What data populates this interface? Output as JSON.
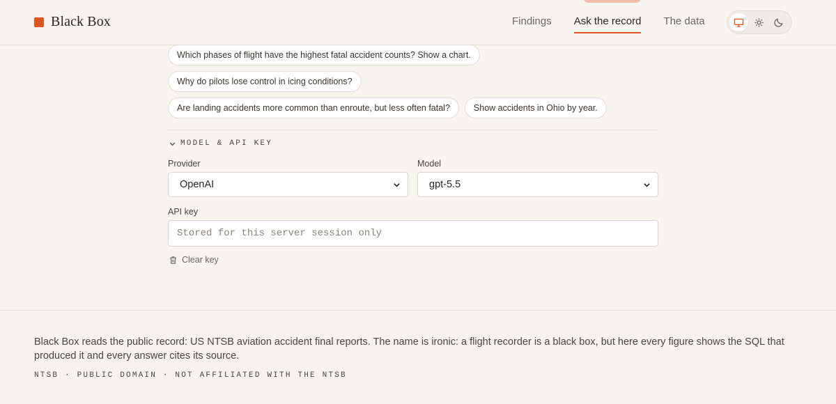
{
  "header": {
    "brand": "Black Box",
    "nav": [
      {
        "label": "Findings"
      },
      {
        "label": "Ask the record"
      },
      {
        "label": "The data"
      }
    ],
    "theme_modes": [
      "monitor-icon",
      "sun-icon",
      "moon-icon"
    ],
    "active_theme": "system"
  },
  "suggestions": [
    "Which phases of flight have the highest fatal accident counts? Show a chart.",
    "Why do pilots lose control in icing conditions?",
    "Are landing accidents more common than enroute, but less often fatal?",
    "Show accidents in Ohio by year."
  ],
  "settings": {
    "section_title": "MODEL & API KEY",
    "provider_label": "Provider",
    "provider_value": "OpenAI",
    "model_label": "Model",
    "model_value": "gpt-5.5",
    "api_key_label": "API key",
    "api_key_placeholder": "Stored for this server session only",
    "clear_key_label": "Clear key"
  },
  "footer": {
    "text": "Black Box reads the public record: US NTSB aviation accident final reports. The name is ironic: a flight recorder is a black box, but here every figure shows the SQL that produced it and every answer cites its source.",
    "meta": "NTSB · PUBLIC DOMAIN · NOT AFFILIATED WITH THE NTSB"
  },
  "colors": {
    "accent": "#e0531f",
    "background": "#f7f5f0",
    "text": "#2a2622"
  }
}
